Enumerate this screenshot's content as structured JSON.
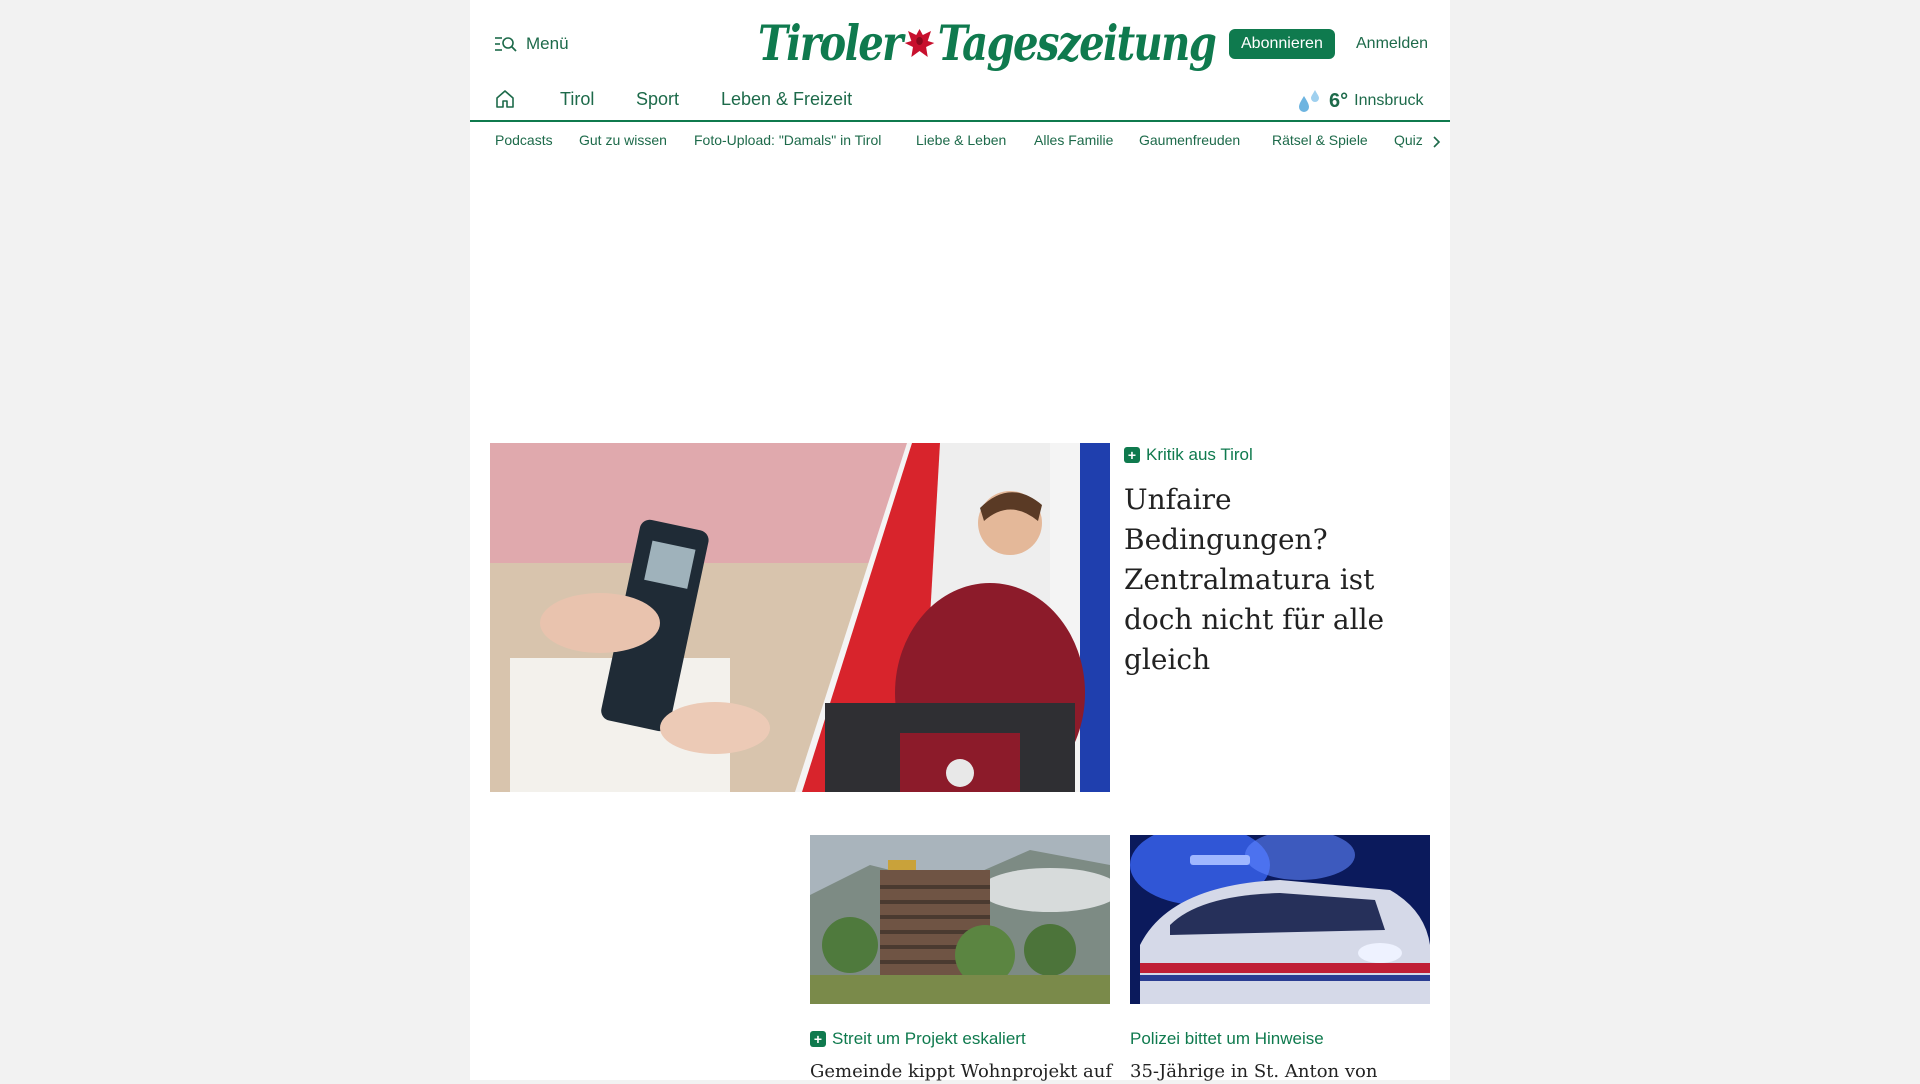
{
  "header": {
    "menu_label": "Menü",
    "logo_left": "Tiroler",
    "logo_right": "Tageszeitung",
    "subscribe_label": "Abonnieren",
    "login_label": "Anmelden"
  },
  "main_nav": {
    "items": [
      {
        "label": "Tirol"
      },
      {
        "label": "Sport"
      },
      {
        "label": "Leben & Freizeit"
      }
    ],
    "weather": {
      "temperature": "6°",
      "city": "Innsbruck",
      "icon": "rain-drops-icon"
    }
  },
  "sub_nav": {
    "items": [
      {
        "label": "Podcasts"
      },
      {
        "label": "Gut zu wissen"
      },
      {
        "label": "Foto-Upload: \"Damals\" in Tirol"
      },
      {
        "label": "Liebe & Leben"
      },
      {
        "label": "Alles Familie"
      },
      {
        "label": "Gaumenfreuden"
      },
      {
        "label": "Rätsel & Spiele"
      },
      {
        "label": "Quiz"
      }
    ]
  },
  "hero": {
    "kicker": "Kritik aus Tirol",
    "title": "Unfaire Bedingungen? Zentralmatura ist doch nicht für alle gleich"
  },
  "cards": [
    {
      "kicker": "Streit um Projekt eskaliert",
      "premium": true,
      "title": "Gemeinde kippt Wohnprojekt auf"
    },
    {
      "kicker": "Polizei bittet um Hinweise",
      "premium": false,
      "title": "35-Jährige in St. Anton von"
    }
  ],
  "colors": {
    "brand_green": "#0f7a4e",
    "nav_text": "#1d6a4a",
    "page_bg": "#f2f2f2"
  }
}
